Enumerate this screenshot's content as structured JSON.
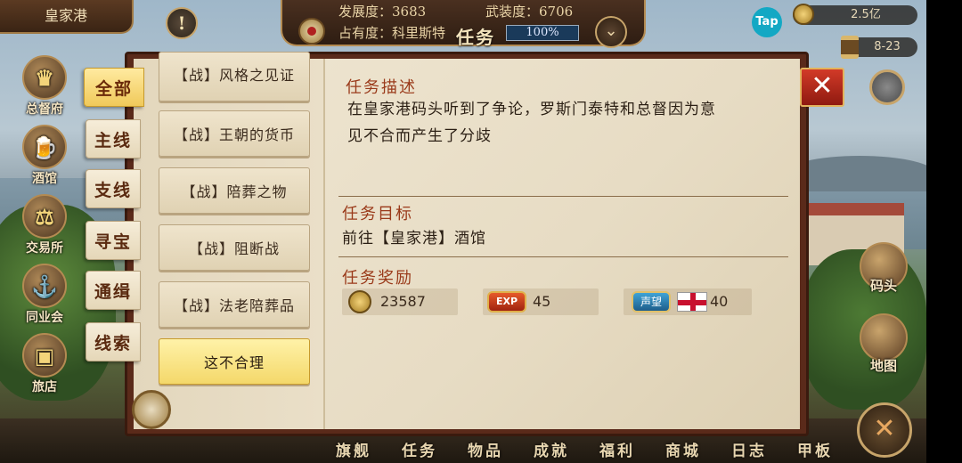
{
  "top": {
    "port_name": "皇家港",
    "alert_symbol": "!",
    "development_label": "发展度：3683",
    "armament_label": "武装度：6706",
    "occupancy_label": "占有度：科里斯特",
    "occupancy_percent": "100%",
    "occupancy_fraction": 1.0,
    "screen_title": "任务",
    "tap_label": "Tap",
    "gold_amount": "2.5亿",
    "time": "8-23"
  },
  "left_buttons": [
    {
      "label": "总督府",
      "icon": "crown-icon"
    },
    {
      "label": "酒馆",
      "icon": "beer-icon"
    },
    {
      "label": "交易所",
      "icon": "scales-icon"
    },
    {
      "label": "同业会",
      "icon": "anchor-shield-icon"
    },
    {
      "label": "旅店",
      "icon": "chest-icon"
    }
  ],
  "tabs": [
    {
      "label": "全部",
      "active": true
    },
    {
      "label": "主线",
      "active": false
    },
    {
      "label": "支线",
      "active": false
    },
    {
      "label": "寻宝",
      "active": false
    },
    {
      "label": "通缉",
      "active": false
    },
    {
      "label": "线索",
      "active": false
    }
  ],
  "quests": [
    {
      "label": "【战】风格之见证",
      "active": false
    },
    {
      "label": "【战】王朝的货币",
      "active": false
    },
    {
      "label": "【战】陪葬之物",
      "active": false
    },
    {
      "label": "【战】阻断战",
      "active": false
    },
    {
      "label": "【战】法老陪葬品",
      "active": false
    },
    {
      "label": "这不合理",
      "active": true
    }
  ],
  "detail": {
    "desc_heading": "任务描述",
    "desc_line1": "在皇家港码头听到了争论，罗斯门泰特和总督因为意",
    "desc_line2": "见不合而产生了分歧",
    "goal_heading": "任务目标",
    "goal_text": "前往【皇家港】酒馆",
    "reward_heading": "任务奖励",
    "reward_gold": "23587",
    "exp_badge": "EXP",
    "reward_exp": "45",
    "rep_badge": "声望",
    "reward_rep": "40"
  },
  "right_buttons": [
    {
      "label": "码头",
      "icon": "dock-icon"
    },
    {
      "label": "地图",
      "icon": "map-scroll-icon"
    }
  ],
  "bottom_nav": [
    "旗舰",
    "任务",
    "物品",
    "成就",
    "福利",
    "商城",
    "日志",
    "甲板"
  ],
  "close_symbol": "✕",
  "cross_symbol": "✕"
}
